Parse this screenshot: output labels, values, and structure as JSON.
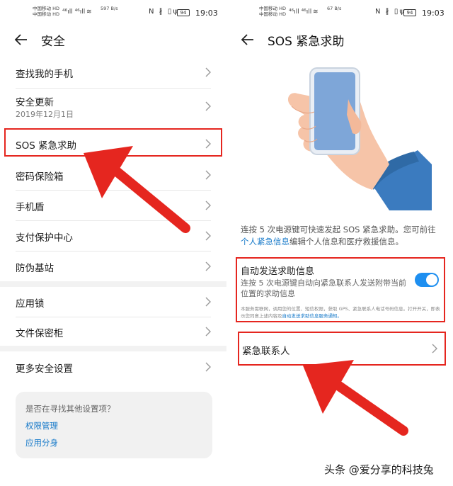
{
  "status_bar": {
    "carrier_line1": "中国移动 HD",
    "carrier_line2": "中国移动 HD",
    "signal_left": "⁴⁶ıll ⁴⁶ıll",
    "speed_left": "597 B/s",
    "speed_right": "67 B/s",
    "status_icons": "Ν ∦ ▯ψ",
    "battery": "94",
    "time": "19:03"
  },
  "left_screen": {
    "title": "安全",
    "items": [
      {
        "label": "查找我的手机"
      },
      {
        "label": "安全更新",
        "sub": "2019年12月1日"
      },
      {
        "label": "SOS 紧急求助"
      },
      {
        "label": "密码保险箱"
      },
      {
        "label": "手机盾"
      },
      {
        "label": "支付保护中心"
      },
      {
        "label": "防伪基站"
      },
      {
        "label": "应用锁"
      },
      {
        "label": "文件保密柜"
      },
      {
        "label": "更多安全设置"
      }
    ],
    "suggest": {
      "question": "是否在寻找其他设置项？",
      "link1": "权限管理",
      "link2": "应用分身"
    }
  },
  "right_screen": {
    "title": "SOS 紧急求助",
    "desc_part1": "连按 5 次电源键可快速发起 SOS 紧急求助。您可前往",
    "desc_link": "个人紧急信息",
    "desc_part2": "编辑个人信息和医疗救援信息。",
    "auto_title": "自动发送求助信息",
    "auto_desc": "连按 5 次电源键自动向紧急联系人发送附带当前位置的求助信息",
    "auto_fine": "本服务需联网，调用您的位置、短信权限，获取 GPS、紧急联系人电话号码信息。打开开关，即表示您同意上述内容及",
    "auto_fine_link": "自动发送求助信息服务通知。",
    "toggle_on": true,
    "contact_label": "紧急联系人"
  },
  "watermark": "头条 @爱分享的科技兔",
  "colors": {
    "highlight_red": "#e5261f",
    "link_blue": "#1679c9",
    "toggle_blue": "#1e8ff0",
    "phone_screen": "#7ea6d8",
    "sleeve_blue": "#3b7bbf",
    "skin": "#f6c4a8"
  }
}
